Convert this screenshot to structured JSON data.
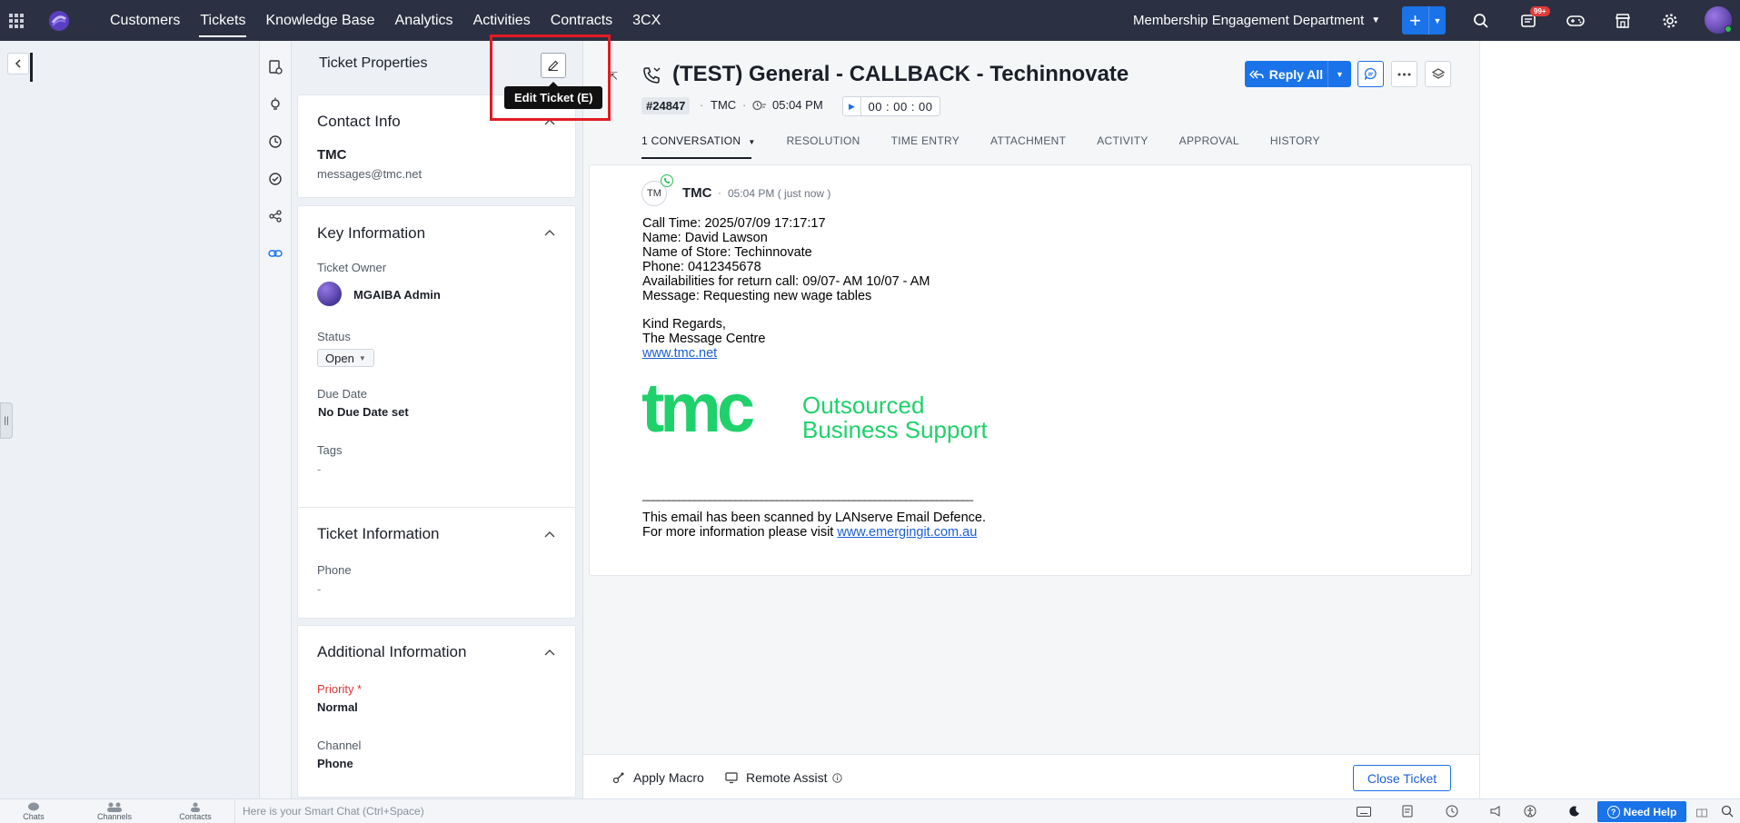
{
  "topnav": {
    "tabs": [
      "Customers",
      "Tickets",
      "Knowledge Base",
      "Analytics",
      "Activities",
      "Contracts",
      "3CX"
    ],
    "active_tab": "Tickets",
    "department": "Membership Engagement Department",
    "notification_badge": "99+",
    "colors": {
      "bar": "#2b3142",
      "accent": "#1a73e8"
    }
  },
  "properties_panel": {
    "title": "Ticket Properties",
    "edit_tooltip": "Edit Ticket (E)",
    "contact_info": {
      "title": "Contact Info",
      "name": "TMC",
      "email": "messages@tmc.net"
    },
    "key_information": {
      "title": "Key Information",
      "owner_label": "Ticket Owner",
      "owner_name": "MGAIBA Admin",
      "status_label": "Status",
      "status_value": "Open",
      "due_label": "Due Date",
      "due_value": "No Due Date set",
      "tags_label": "Tags",
      "tags_value": "-"
    },
    "ticket_information": {
      "title": "Ticket Information",
      "phone_label": "Phone",
      "phone_value": "-"
    },
    "additional_information": {
      "title": "Additional Information",
      "priority_label": "Priority *",
      "priority_value": "Normal",
      "channel_label": "Channel",
      "channel_value": "Phone"
    }
  },
  "ticket": {
    "title": "(TEST) General - CALLBACK - Techinnovate",
    "id": "#24847",
    "contact": "TMC",
    "time": "05:04 PM",
    "timer": "00 : 00 : 00",
    "reply_all_label": "Reply All",
    "tabs": [
      "1 CONVERSATION",
      "RESOLUTION",
      "TIME ENTRY",
      "ATTACHMENT",
      "ACTIVITY",
      "APPROVAL",
      "HISTORY"
    ]
  },
  "conversation": {
    "avatar_initials": "TM",
    "sender": "TMC",
    "timestamp": "05:04 PM ( just now )",
    "lines": [
      "Call Time: 2025/07/09 17:17:17",
      "Name: David Lawson",
      "Name of Store: Techinnovate",
      "Phone: 0412345678",
      "Availabilities for return call: 09/07- AM 10/07 - AM",
      "Message: Requesting new wage tables"
    ],
    "signoff_1": "Kind Regards,",
    "signoff_2": "The Message Centre",
    "website": "www.tmc.net",
    "logo_text": "tmc",
    "logo_tagline_1": "Outsourced",
    "logo_tagline_2": "Business Support",
    "divider": "________________________________________________________________",
    "scan_notice": "This email has been scanned by LANserve Email Defence.",
    "more_info_prefix": "For more information please visit ",
    "more_info_link": "www.emergingit.com.au",
    "logo_color": "#1fd16b"
  },
  "bottom_actions": {
    "apply_macro": "Apply Macro",
    "remote_assist": "Remote Assist",
    "close_ticket": "Close Ticket"
  },
  "footer": {
    "chats": "Chats",
    "channels": "Channels",
    "contacts": "Contacts",
    "smart_chat_placeholder": "Here is your Smart Chat (Ctrl+Space)",
    "need_help": "Need Help"
  }
}
